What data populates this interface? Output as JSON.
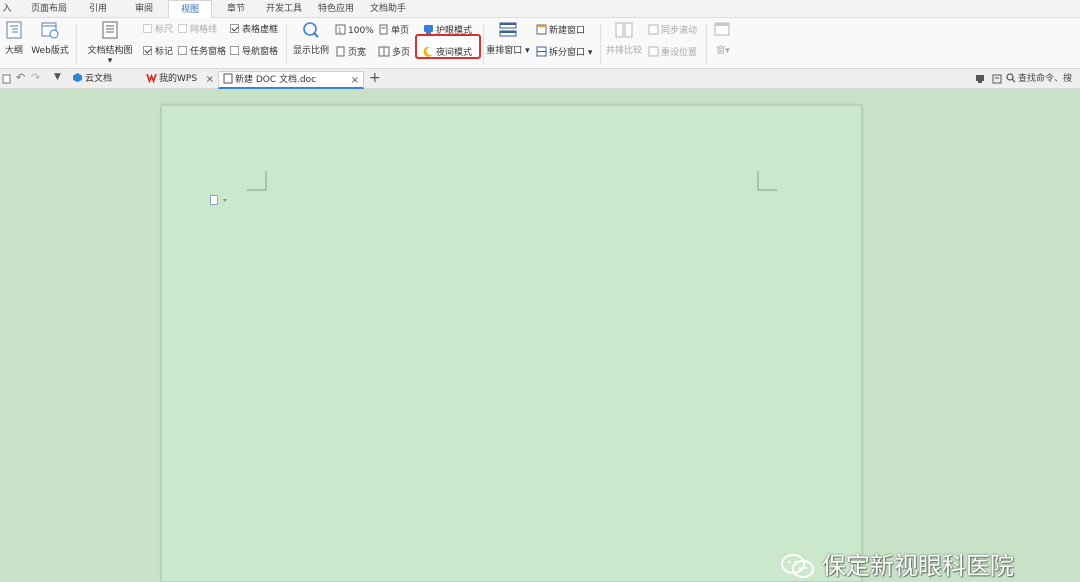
{
  "menu_tabs": [
    "入",
    "页面布局",
    "引用",
    "审阅",
    "视图",
    "章节",
    "开发工具",
    "特色应用",
    "文档助手"
  ],
  "active_menu_tab": "视图",
  "ribbon": {
    "outline": "大纲",
    "web_layout": "Web版式",
    "doc_structure": "文档结构图",
    "ruler": "标尺",
    "gridlines": "网格线",
    "table_gridlines": "表格虚框",
    "markup": "标记",
    "task_pane": "任务窗格",
    "nav_pane": "导航窗格",
    "zoom": "显示比例",
    "zoom_100": "100%",
    "page_width": "页宽",
    "single_page": "单页",
    "multi_page": "多页",
    "eye_protection": "护眼模式",
    "night_mode": "夜间模式",
    "arrange_windows": "重排窗口",
    "new_window": "新建窗口",
    "split_window": "拆分窗口",
    "side_by_side": "并排比较",
    "sync_scroll": "同步滚动",
    "reset_position": "重设位置",
    "switch_window": "窗"
  },
  "doc_tabs": [
    {
      "label": "云文档"
    },
    {
      "label": "我的WPS"
    },
    {
      "label": "新建 DOC 文档.doc"
    }
  ],
  "search": {
    "label": "查找命令、搜"
  },
  "watermark": {
    "text": "保定新视眼科医院"
  },
  "colors": {
    "workspace_bg": "#c7e2c7",
    "page_bg": "#cce8cc",
    "highlight_border": "#d9302b",
    "active_tab": "#2f6bb5"
  }
}
